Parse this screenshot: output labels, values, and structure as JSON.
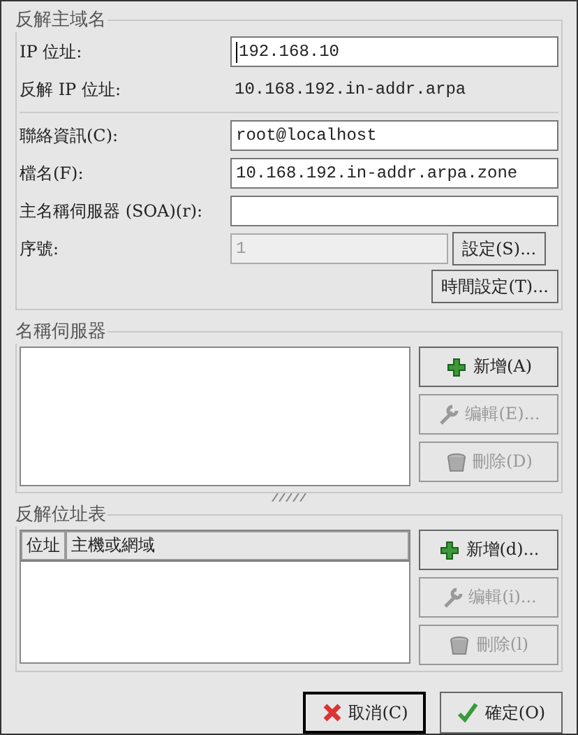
{
  "zone_frame": {
    "title": "反解主域名",
    "rows": [
      {
        "kind": "input",
        "label": "IP 位址:",
        "value": "192.168.10",
        "focused": true
      },
      {
        "kind": "text",
        "label": "反解 IP 位址:",
        "value": "10.168.192.in-addr.arpa"
      },
      {
        "kind": "separator"
      },
      {
        "kind": "input",
        "label": "聯絡資訊(C):",
        "value": "root@localhost"
      },
      {
        "kind": "input",
        "label": "檔名(F):",
        "value": "10.168.192.in-addr.arpa.zone"
      },
      {
        "kind": "input",
        "label": "主名稱伺服器 (SOA)(r):"
      },
      {
        "kind": "input_button",
        "label": "序號:",
        "value": "1",
        "disabled": true,
        "button": "設定(S)..."
      }
    ],
    "extra_button": "時間設定(T)..."
  },
  "nameserver_frame": {
    "title": "名稱伺服器",
    "buttons": [
      {
        "kind": "add",
        "label": "新增(A)",
        "disabled": false
      },
      {
        "kind": "edit",
        "label": "编輯(E)...",
        "disabled": true
      },
      {
        "kind": "delete",
        "label": "刪除(D)",
        "disabled": true
      }
    ]
  },
  "reverse_table_frame": {
    "title": "反解位址表",
    "columns": [
      "位址",
      "主機或網域"
    ],
    "buttons": [
      {
        "kind": "add",
        "label": "新增(d)...",
        "disabled": false
      },
      {
        "kind": "edit",
        "label": "编輯(i)...",
        "disabled": true
      },
      {
        "kind": "delete",
        "label": "刪除(l)",
        "disabled": true
      }
    ]
  },
  "dialog_buttons": [
    {
      "kind": "cancel",
      "label": "取消(C)",
      "focused": true
    },
    {
      "kind": "ok",
      "label": "確定(O)",
      "focused": false
    }
  ]
}
